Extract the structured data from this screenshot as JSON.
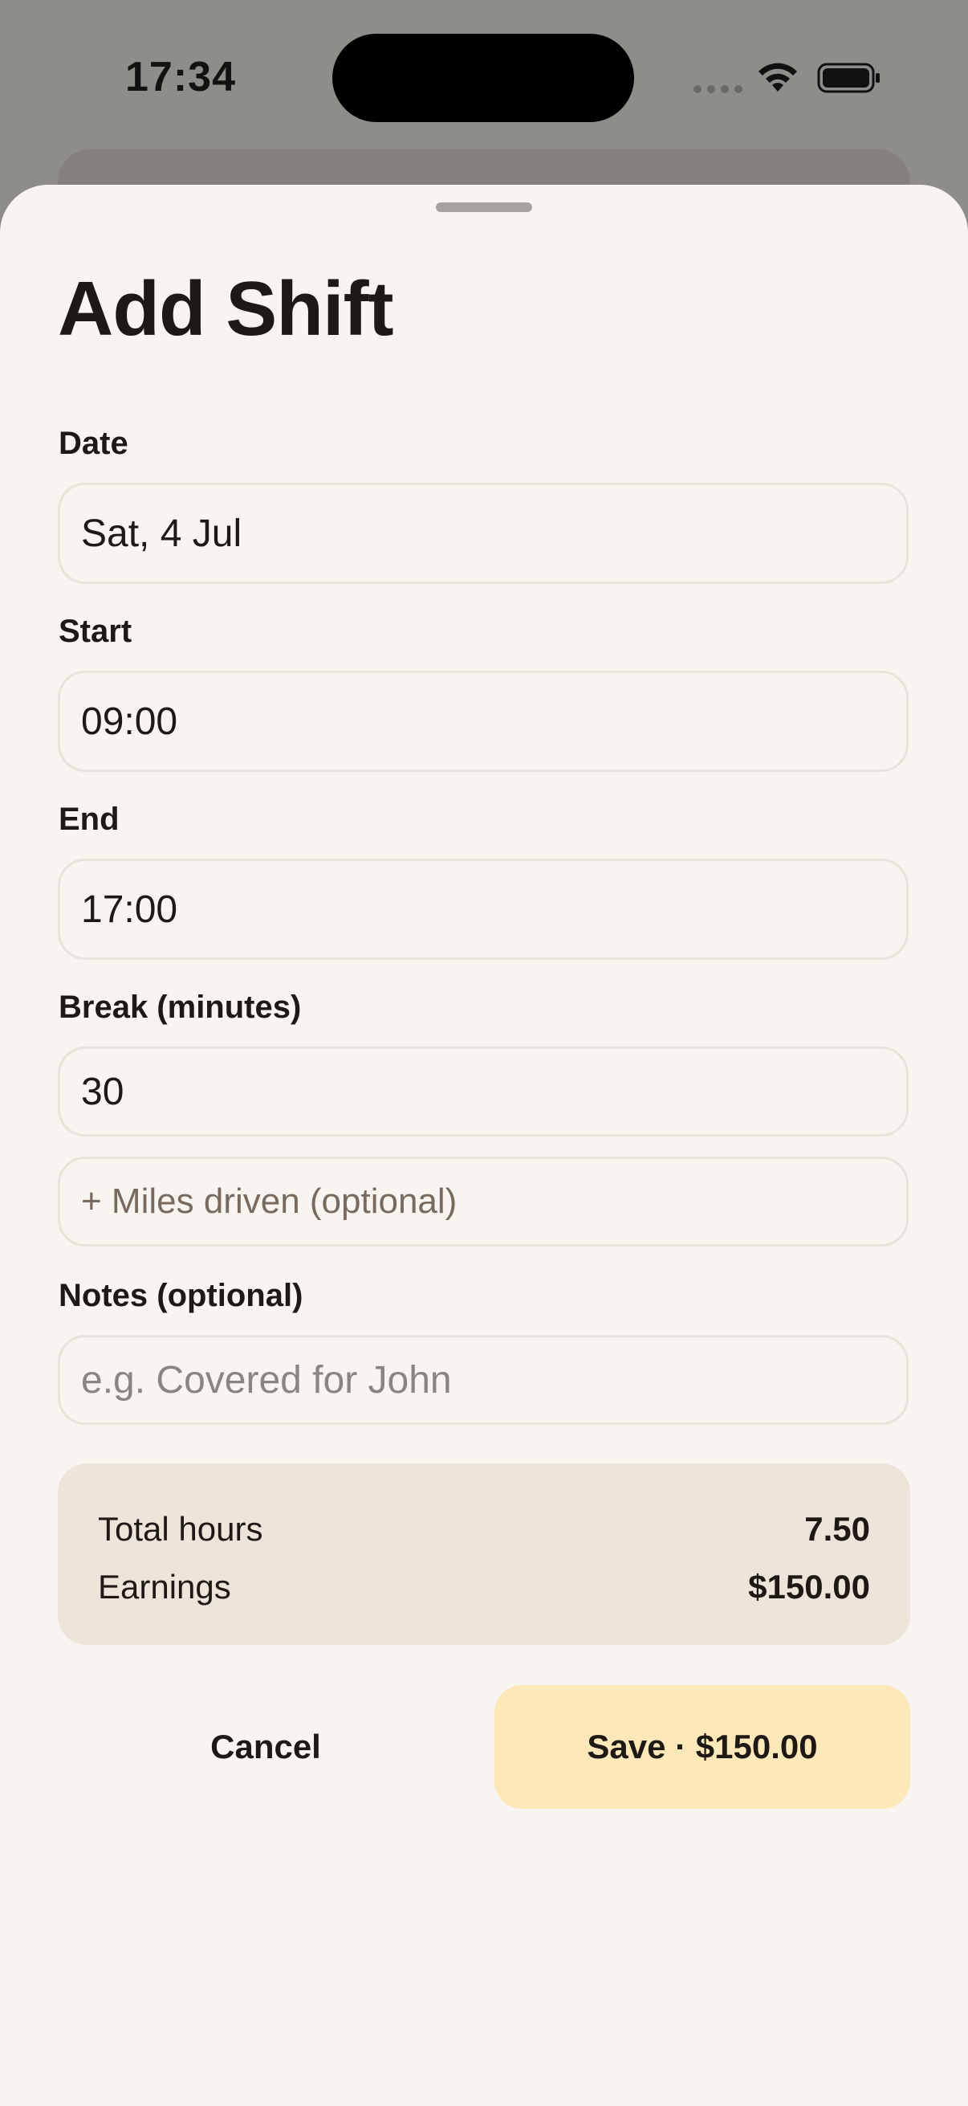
{
  "status_bar": {
    "time": "17:34",
    "icons": [
      "cellular-dots-icon",
      "wifi-icon",
      "battery-icon"
    ]
  },
  "sheet": {
    "title": "Add Shift",
    "fields": {
      "date": {
        "label": "Date",
        "value": "Sat, 4 Jul"
      },
      "start": {
        "label": "Start",
        "value": "09:00"
      },
      "end": {
        "label": "End",
        "value": "17:00"
      },
      "break": {
        "label": "Break (minutes)",
        "value": "30"
      },
      "miles": {
        "link": "+ Miles driven (optional)"
      },
      "notes": {
        "label": "Notes (optional)",
        "value": "",
        "placeholder": "e.g. Covered for John"
      }
    },
    "summary": {
      "total_hours_label": "Total hours",
      "total_hours_value": "7.50",
      "earnings_label": "Earnings",
      "earnings_value": "$150.00"
    },
    "actions": {
      "cancel_label": "Cancel",
      "save_label": "Save · $150.00"
    }
  },
  "colors": {
    "sheet_background": "#f8f5f0",
    "backdrop": "#8f8d8a",
    "summary_background": "#ede5da",
    "save_button": "#fde8ba",
    "text_primary": "#1e1915",
    "text_muted": "#8a8581"
  }
}
